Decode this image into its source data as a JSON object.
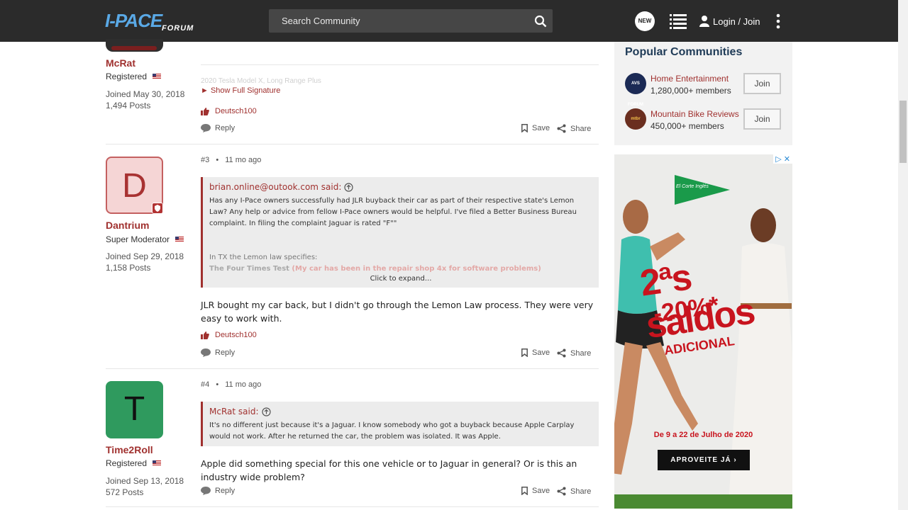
{
  "header": {
    "logo_main": "I-PACE",
    "logo_sub": "FORUM",
    "search_placeholder": "Search Community",
    "new_label": "NEW",
    "login_label": "Login / Join"
  },
  "posts": [
    {
      "user": "McRat",
      "role": "Registered",
      "joined": "Joined May 30, 2018",
      "posts_count": "1,494 Posts",
      "signature": "2020 Tesla Model X, Long Range Plus",
      "show_signature": "► Show Full Signature",
      "liker": "Deutsch100",
      "reply": "Reply",
      "save": "Save",
      "share": "Share"
    },
    {
      "user": "Dantrium",
      "role": "Super Moderator",
      "avatar_letter": "D",
      "joined": "Joined Sep 29, 2018",
      "posts_count": "1,158 Posts",
      "number": "#3",
      "time": "11 mo ago",
      "quote_author": "brian.online@outook.com said:",
      "quote_text": "Has any I-Pace owners successfully had JLR buyback their car as part of their respective state's Lemon Law? Any help or advice from fellow I-Pace owners would be helpful. I've filed a Better Business Bureau complaint. In filing the complaint Jaguar is rated \"F\"\"",
      "quote_text2": "In TX the Lemon law specifies:",
      "quote_text3a": "The Four Times Test",
      "quote_text3b": "(My car has been in the repair shop 4x for software problems)",
      "expand": "Click to expand...",
      "body": "JLR bought my car back, but I didn't go through the Lemon Law process. They were very easy to work with.",
      "liker": "Deutsch100",
      "reply": "Reply",
      "save": "Save",
      "share": "Share"
    },
    {
      "user": "Time2Roll",
      "role": "Registered",
      "avatar_letter": "T",
      "joined": "Joined Sep 13, 2018",
      "posts_count": "572 Posts",
      "number": "#4",
      "time": "11 mo ago",
      "quote_author": "McRat said:",
      "quote_text": "It's no different just because it's a Jaguar. I know somebody who got a buyback because Apple Carplay would not work. After he returned the car, the problem was isolated. It was Apple.",
      "body": "Apple did something special for this one vehicle or to Jaguar in general? Or is this an industry wide problem?",
      "reply": "Reply",
      "save": "Save",
      "share": "Share"
    }
  ],
  "sidebar": {
    "title": "Popular Communities",
    "communities": [
      {
        "name": "Home Entertainment",
        "members": "1,280,000+ members",
        "join": "Join",
        "icon_text": "AVS FORUM"
      },
      {
        "name": "Mountain Bike Reviews",
        "members": "450,000+ members",
        "join": "Join",
        "icon_text": "mtbr"
      }
    ]
  },
  "ad": {
    "brand": "El Corte Inglés",
    "headline": "2ªs saldos",
    "discount": "-20%*",
    "sub": "ADICIONAL",
    "dates": "De 9 a 22 de Julho de 2020",
    "cta": "APROVEITE JÁ ›"
  }
}
